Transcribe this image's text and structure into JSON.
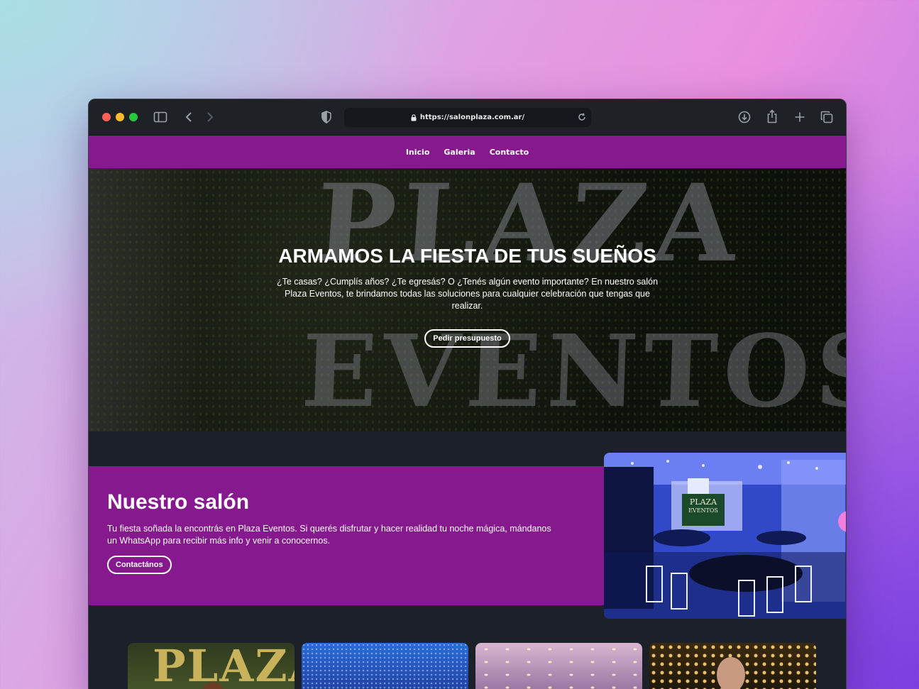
{
  "browser": {
    "url": "https://salonplaza.com.ar/"
  },
  "nav": {
    "items": [
      "Inicio",
      "Galeria",
      "Contacto"
    ]
  },
  "hero": {
    "background_text_top": "PLAZA",
    "background_text_bottom": "EVENTOS",
    "title": "ARMAMOS LA FIESTA DE TUS SUEÑOS",
    "description": "¿Te casas? ¿Cumplís años? ¿Te egresás? O ¿Tenés algún evento importante? En nuestro salón Plaza Eventos, te brindamos todas las soluciones para cualquier celebración que tengas que realizar.",
    "button": "Pedir presupuesto"
  },
  "salon": {
    "title": "Nuestro salón",
    "description": "Tu fiesta soñada la encontrás en Plaza Eventos. Si querés disfrutar y hacer realidad tu noche mágica, mándanos un WhatsApp para recibir más info y venir a conocernos.",
    "button": "Contactános",
    "image_sign_line1": "PLAZA",
    "image_sign_line2": "EVENTOS"
  },
  "gallery": {
    "first_image_text": "PLAZA"
  },
  "colors": {
    "brand_purple": "#87198f",
    "page_dark": "#1c2129"
  }
}
